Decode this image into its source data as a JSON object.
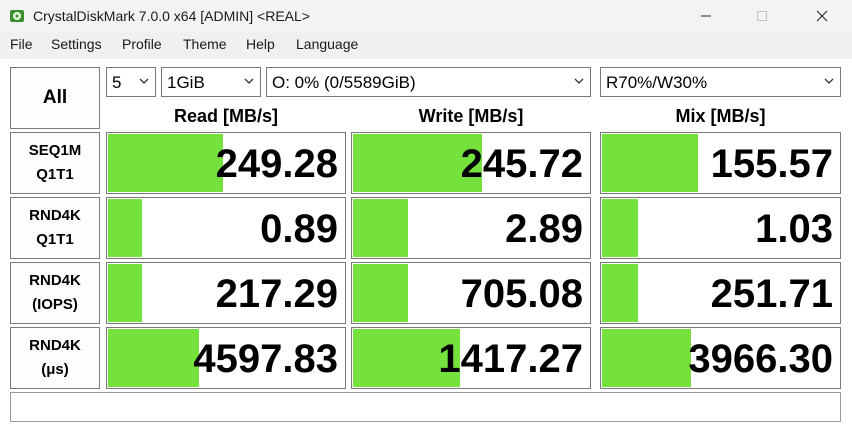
{
  "window": {
    "title": "CrystalDiskMark 7.0.0 x64 [ADMIN] <REAL>"
  },
  "menu": [
    "File",
    "Settings",
    "Profile",
    "Theme",
    "Help",
    "Language"
  ],
  "controls": {
    "all_label": "All",
    "count": "5",
    "size": "1GiB",
    "drive": "O: 0% (0/5589GiB)",
    "mix": "R70%/W30%"
  },
  "columns": [
    "Read [MB/s]",
    "Write [MB/s]",
    "Mix [MB/s]"
  ],
  "rows": [
    {
      "line1": "SEQ1M",
      "line2": "Q1T1",
      "cells": [
        {
          "value": "249.28",
          "fill": 0.49
        },
        {
          "value": "245.72",
          "fill": 0.55
        },
        {
          "value": "155.57",
          "fill": 0.41
        }
      ]
    },
    {
      "line1": "RND4K",
      "line2": "Q1T1",
      "cells": [
        {
          "value": "0.89",
          "fill": 0.15
        },
        {
          "value": "2.89",
          "fill": 0.24
        },
        {
          "value": "1.03",
          "fill": 0.16
        }
      ]
    },
    {
      "line1": "RND4K",
      "line2": "(IOPS)",
      "cells": [
        {
          "value": "217.29",
          "fill": 0.15
        },
        {
          "value": "705.08",
          "fill": 0.24
        },
        {
          "value": "251.71",
          "fill": 0.16
        }
      ]
    },
    {
      "line1": "RND4K",
      "line2": "(μs)",
      "cells": [
        {
          "value": "4597.83",
          "fill": 0.39
        },
        {
          "value": "1417.27",
          "fill": 0.46
        },
        {
          "value": "3966.30",
          "fill": 0.38
        }
      ]
    }
  ],
  "colors": {
    "bar": "#74e13c",
    "border": "#7a7a7a"
  },
  "icons": [
    "app-disk-icon",
    "minimize-icon",
    "maximize-icon",
    "close-icon",
    "chevron-down-icon"
  ]
}
